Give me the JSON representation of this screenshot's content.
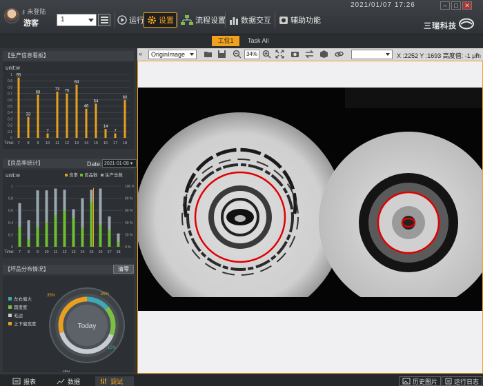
{
  "user": {
    "status": "未登陆",
    "name": "游客"
  },
  "station_select": {
    "value": "1"
  },
  "nav": {
    "run": "运行",
    "settings": "设置",
    "flow": "流程设置",
    "data": "数据交互",
    "aux": "辅助功能"
  },
  "datetime": "2021/01/07  17:26",
  "brand": "三瑞科技",
  "tabs": {
    "station1": "工位1",
    "task_all": "Task All"
  },
  "production_panel": {
    "title": "【生产信息看板】",
    "unit": "unit:w",
    "time_label": "Time:"
  },
  "quality_panel": {
    "title": "【良品率统计】",
    "date_label": "Date:",
    "date_value": "2021-01-08",
    "unit": "unit:w",
    "legend": [
      "良率",
      "良品数",
      "生产总数"
    ],
    "time_label": "Time:"
  },
  "defect_panel": {
    "title": "【坏品分布情况】",
    "clear_label": "清零",
    "legend": [
      "左右偏大",
      "圆度度",
      "毛边",
      "上下偏宽度"
    ],
    "center_label": "Today",
    "percent_labels": [
      "26%",
      "12%",
      "15%",
      "35%"
    ]
  },
  "chart_data": [
    {
      "type": "bar",
      "title": "生产信息看板",
      "ylabel": "unit:w",
      "categories": [
        "7",
        "8",
        "9",
        "10",
        "11",
        "12",
        "13",
        "14",
        "15",
        "16",
        "17",
        "18"
      ],
      "values": [
        95,
        33,
        68,
        7,
        73,
        70,
        84,
        46,
        54,
        14,
        7,
        60
      ],
      "ylim": [
        0,
        100
      ],
      "yticks": [
        "0",
        "0.1",
        "0.2",
        "0.3",
        "0.4",
        "0.5",
        "0.6",
        "0.7",
        "0.8",
        "0.9",
        "1"
      ],
      "colors": {
        "bar": "#e7a020"
      }
    },
    {
      "type": "bar",
      "title": "良品率统计",
      "ylabel": "unit:w",
      "categories": [
        "7",
        "8",
        "9",
        "10",
        "11",
        "12",
        "13",
        "14",
        "15",
        "16",
        "17",
        "18"
      ],
      "series": [
        {
          "name": "生产总数",
          "values": [
            0.72,
            0.44,
            0.93,
            0.93,
            0.96,
            0.94,
            0.62,
            0.8,
            0.94,
            0.96,
            0.5,
            0.22
          ]
        },
        {
          "name": "良品数",
          "values": [
            0.33,
            0.12,
            0.32,
            0.4,
            0.52,
            0.6,
            0.47,
            0.32,
            0.74,
            0.36,
            0.28,
            0.08
          ]
        },
        {
          "name": "良率",
          "values": [
            null,
            null,
            null,
            null,
            null,
            null,
            null,
            null,
            0.97,
            null,
            null,
            null
          ]
        }
      ],
      "ylim": [
        0,
        1
      ],
      "yticks": [
        "0",
        "0.2",
        "0.4",
        "0.6",
        "0.8",
        "1"
      ],
      "y2ticks": [
        "0 %",
        "20 %",
        "40 %",
        "60 %",
        "80 %",
        "100 %"
      ],
      "colors": {
        "total": "#9aa6b0",
        "good": "#6ebe2f",
        "rate": "#e7a020"
      }
    },
    {
      "type": "pie",
      "title": "坏品分布情况",
      "categories": [
        "左右偏大",
        "圆度度",
        "毛边",
        "上下偏宽度"
      ],
      "values": [
        12,
        15,
        35,
        26
      ],
      "colors": [
        "#3fa8b5",
        "#7bc043",
        "#c8ccd0",
        "#e7a020"
      ]
    }
  ],
  "bottom": {
    "report": "报表",
    "data": "数据",
    "debug": "调试",
    "history": "历史图片",
    "log": "运行日志"
  },
  "viewer": {
    "image_select": "OriginImage",
    "zoom": "34%",
    "coords": "X :2252 Y :1693 高度值: -1 μm"
  }
}
